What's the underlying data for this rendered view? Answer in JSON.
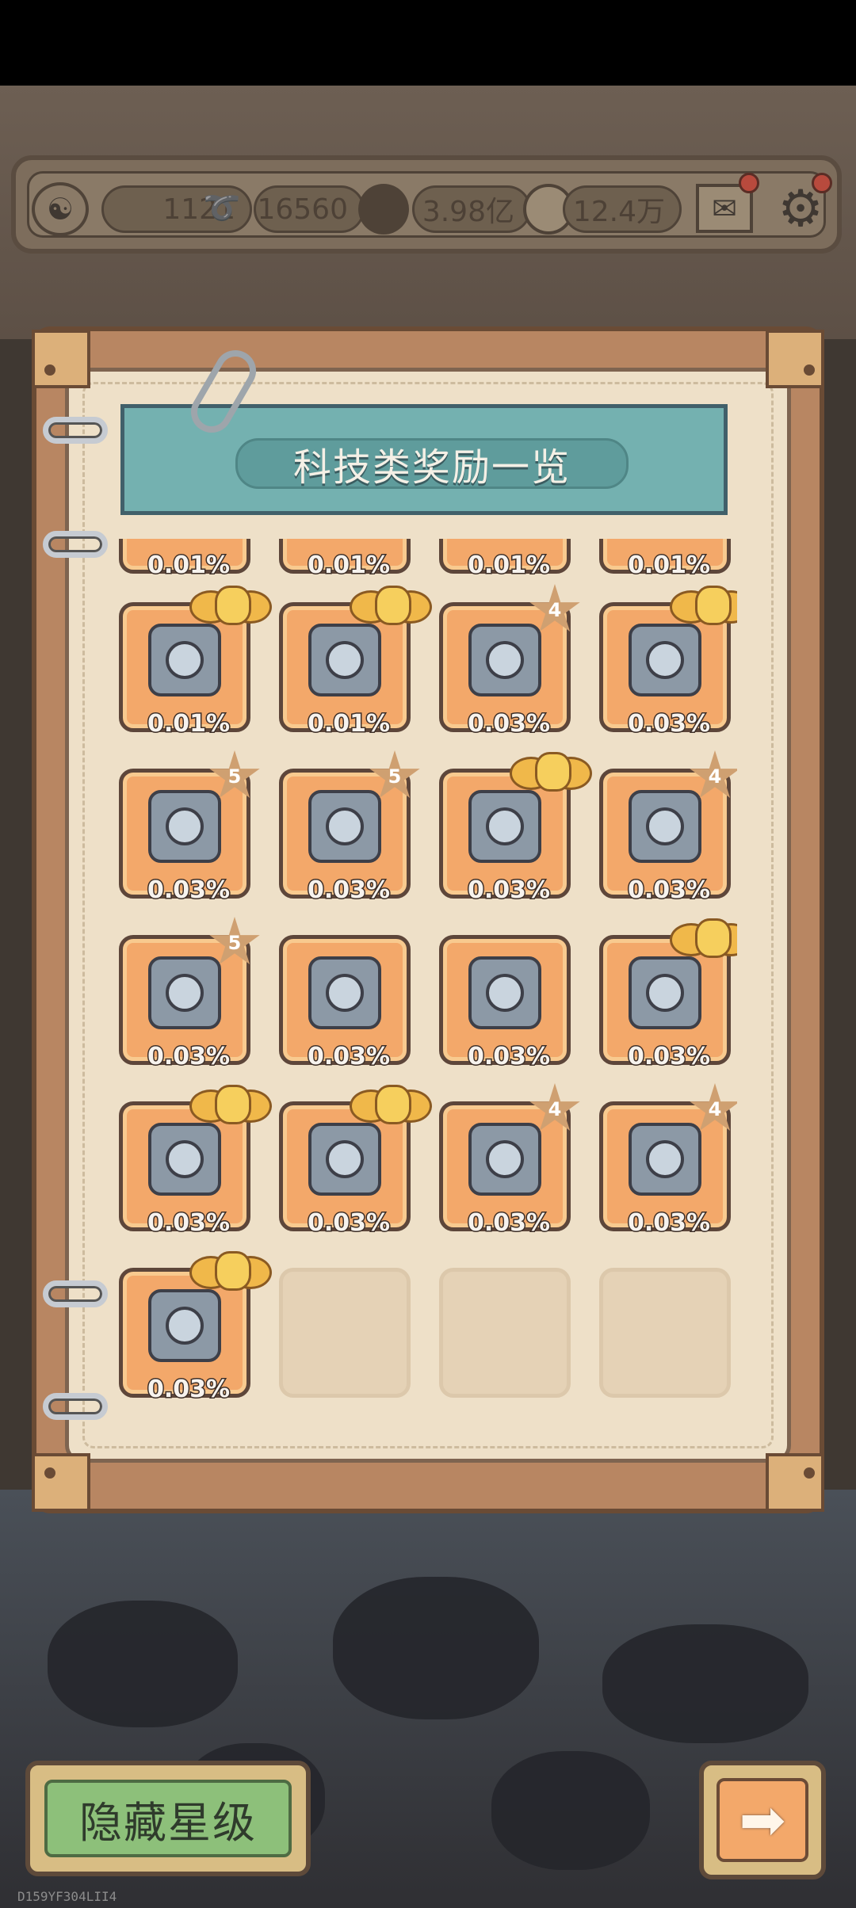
{
  "resources": {
    "c1": "1121",
    "c2": "16560",
    "c3": "3.98亿",
    "c4": "12.4万",
    "icons": [
      "yin-yang-icon",
      "soul-ghost-icon",
      "gem-bubble-icon",
      "speech-bubble-icon"
    ]
  },
  "panel": {
    "title": "科技类奖励一览",
    "rows": [
      [
        {
          "pct": "0.01%",
          "badge": null
        },
        {
          "pct": "0.01%",
          "badge": null
        },
        {
          "pct": "0.01%",
          "badge": null
        },
        {
          "pct": "0.01%",
          "badge": null
        }
      ],
      [
        {
          "pct": "0.01%",
          "badge": "wings",
          "icon": "gear-ring-machine-icon"
        },
        {
          "pct": "0.01%",
          "badge": "wings",
          "icon": "crystal-cube-pile-icon"
        },
        {
          "pct": "0.03%",
          "badge": "4",
          "icon": "console-machine-icon"
        },
        {
          "pct": "0.03%",
          "badge": "wings",
          "icon": "rocket-fish-icon"
        }
      ],
      [
        {
          "pct": "0.03%",
          "badge": "5",
          "icon": "tower-machine-icon"
        },
        {
          "pct": "0.03%",
          "badge": "5",
          "icon": "drum-machine-icon"
        },
        {
          "pct": "0.03%",
          "badge": "wings",
          "icon": "scroll-drum-icon"
        },
        {
          "pct": "0.03%",
          "badge": "4",
          "icon": "lantern-cage-icon"
        }
      ],
      [
        {
          "pct": "0.03%",
          "badge": "5",
          "icon": "book-portrait-icon"
        },
        {
          "pct": "0.03%",
          "badge": null,
          "icon": "glass-cube-icon"
        },
        {
          "pct": "0.03%",
          "badge": null,
          "icon": "ancient-book-icon"
        },
        {
          "pct": "0.03%",
          "badge": "wings",
          "icon": "satellite-icon"
        }
      ],
      [
        {
          "pct": "0.03%",
          "badge": "wings",
          "icon": "horn-device-icon"
        },
        {
          "pct": "0.03%",
          "badge": "wings",
          "icon": "telescope-icon"
        },
        {
          "pct": "0.03%",
          "badge": "4",
          "icon": "portrait-book-icon"
        },
        {
          "pct": "0.03%",
          "badge": "4",
          "icon": "wave-book-icon"
        }
      ],
      [
        {
          "pct": "0.03%",
          "badge": "wings",
          "icon": "framed-portrait-icon"
        },
        {
          "pct": "",
          "badge": "empty"
        },
        {
          "pct": "",
          "badge": "empty"
        },
        {
          "pct": "",
          "badge": "empty"
        }
      ]
    ]
  },
  "buttons": {
    "hide_stars": "隐藏星级",
    "next_arrow": "➡"
  },
  "device_id": "D159YF304LII4",
  "colors": {
    "cell_orange": "#f3a86a",
    "title_teal": "#74b1b0",
    "hide_green": "#8dc07a"
  }
}
